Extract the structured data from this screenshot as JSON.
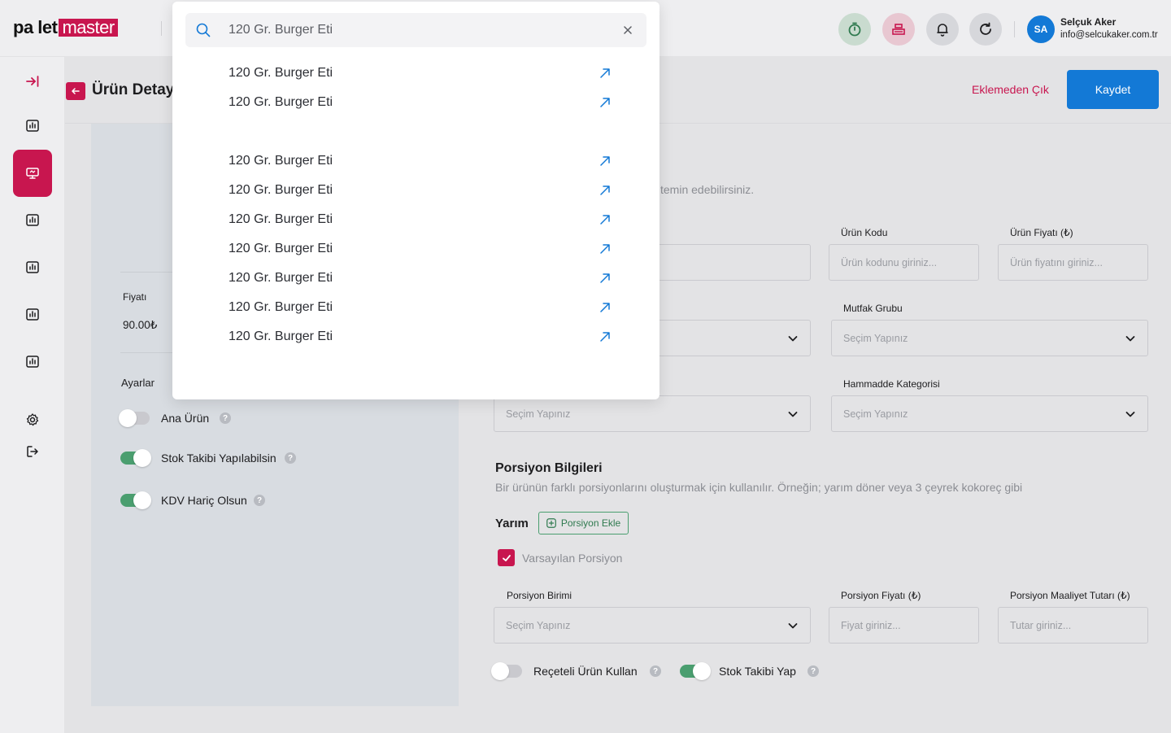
{
  "brand": {
    "part1": "pa let",
    "part2": "master",
    "accent": "#c8164f"
  },
  "user": {
    "initials": "SA",
    "name": "Selçuk Aker",
    "email": "info@selcukaker.com.tr"
  },
  "page": {
    "title": "Ürün Detay",
    "exit_label": "Eklemeden Çık",
    "save_label": "Kaydet"
  },
  "search": {
    "value": "120 Gr. Burger Eti",
    "results": [
      "120 Gr. Burger Eti",
      "120 Gr. Burger Eti",
      "120 Gr. Burger Eti",
      "120 Gr. Burger Eti",
      "120 Gr. Burger Eti",
      "120 Gr. Burger Eti",
      "120 Gr. Burger Eti",
      "120 Gr. Burger Eti",
      "120 Gr. Burger Eti"
    ]
  },
  "left": {
    "price_label": "Fiyatı",
    "price_value": "90.00₺",
    "settings_label": "Ayarlar",
    "toggles": [
      {
        "label": "Ana Ürün",
        "on": false
      },
      {
        "label": "Stok Takibi Yapılabilsin",
        "on": true
      },
      {
        "label": "KDV Hariç Olsun",
        "on": true
      }
    ]
  },
  "form": {
    "intro_fragment": "temin edebilirsiniz.",
    "product_code_label": "Ürün Kodu",
    "product_code_placeholder": "Ürün kodunu giriniz...",
    "product_price_label": "Ürün Fiyatı (₺)",
    "product_price_placeholder": "Ürün fiyatını giriniz...",
    "kitchen_group_label": "Mutfak Grubu",
    "select_placeholder": "Seçim Yapınız",
    "raw_category_label": "Hammadde Kategorisi"
  },
  "portion": {
    "title": "Porsiyon Bilgileri",
    "desc": "Bir ürünün farklı porsiyonlarını oluşturmak için kullanılır. Örneğin; yarım döner veya 3 çeyrek kokoreç gibi",
    "name": "Yarım",
    "add_label": "Porsiyon Ekle",
    "default_label": "Varsayılan Porsiyon",
    "unit_label": "Porsiyon Birimi",
    "price_label": "Porsiyon Fiyatı (₺)",
    "price_placeholder": "Fiyat giriniz...",
    "cost_label": "Porsiyon Maaliyet Tutarı (₺)",
    "cost_placeholder": "Tutar giriniz...",
    "recipe_label": "Reçeteli Ürün Kullan",
    "stock_label": "Stok Takibi Yap"
  }
}
